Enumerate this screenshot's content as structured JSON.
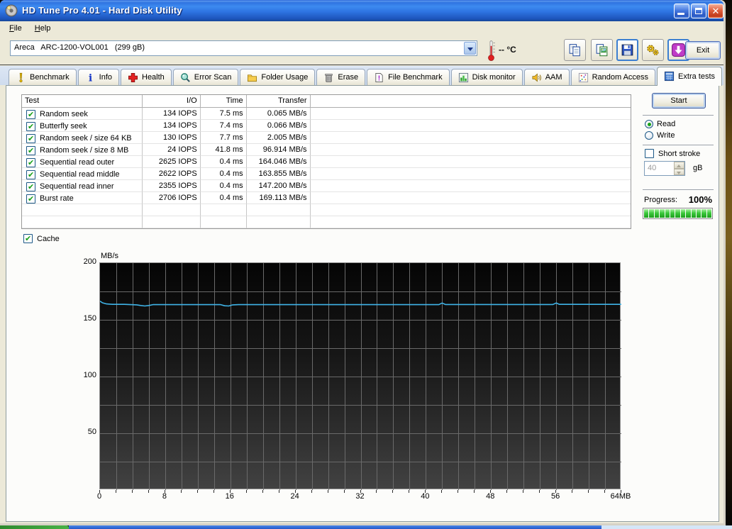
{
  "window": {
    "title": "HD Tune Pro 4.01 - Hard Disk Utility",
    "menu": [
      "File",
      "Help"
    ],
    "controls": [
      "minimize-icon",
      "restore-icon",
      "close-icon"
    ],
    "drive_selector": "Areca   ARC-1200-VOL001   (299 gB)",
    "temperature": "--  °C",
    "toolbar_buttons": [
      {
        "name": "copy-text-button",
        "icon": "copy-icon",
        "focused": false
      },
      {
        "name": "copy-image-button",
        "icon": "copy-image-icon",
        "focused": false
      },
      {
        "name": "save-button",
        "icon": "save-icon",
        "focused": true
      },
      {
        "name": "options-button",
        "icon": "options-icon",
        "focused": false
      },
      {
        "name": "download-button",
        "icon": "download-icon",
        "focused": true
      }
    ],
    "exit_label": "Exit"
  },
  "active_tab": "Extra tests",
  "tabs": [
    {
      "label": "Benchmark",
      "icon": "benchmark-icon"
    },
    {
      "label": "Info",
      "icon": "info-icon"
    },
    {
      "label": "Health",
      "icon": "health-icon"
    },
    {
      "label": "Error Scan",
      "icon": "error-scan-icon"
    },
    {
      "label": "Folder Usage",
      "icon": "folder-icon"
    },
    {
      "label": "Erase",
      "icon": "erase-icon"
    },
    {
      "label": "File Benchmark",
      "icon": "file-benchmark-icon"
    },
    {
      "label": "Disk monitor",
      "icon": "disk-monitor-icon"
    },
    {
      "label": "AAM",
      "icon": "aam-icon"
    },
    {
      "label": "Random Access",
      "icon": "random-access-icon"
    },
    {
      "label": "Extra tests",
      "icon": "extra-tests-icon"
    }
  ],
  "results_table": {
    "columns": [
      "Test",
      "I/O",
      "Time",
      "Transfer"
    ],
    "rows": [
      {
        "checked": true,
        "test": "Random seek",
        "io": "134 IOPS",
        "time": "7.5 ms",
        "transfer": "0.065 MB/s"
      },
      {
        "checked": true,
        "test": "Butterfly seek",
        "io": "134 IOPS",
        "time": "7.4 ms",
        "transfer": "0.066 MB/s"
      },
      {
        "checked": true,
        "test": "Random seek / size 64 KB",
        "io": "130 IOPS",
        "time": "7.7 ms",
        "transfer": "2.005 MB/s"
      },
      {
        "checked": true,
        "test": "Random seek / size 8 MB",
        "io": "24 IOPS",
        "time": "41.8 ms",
        "transfer": "96.914 MB/s"
      },
      {
        "checked": true,
        "test": "Sequential read outer",
        "io": "2625 IOPS",
        "time": "0.4 ms",
        "transfer": "164.046 MB/s"
      },
      {
        "checked": true,
        "test": "Sequential read middle",
        "io": "2622 IOPS",
        "time": "0.4 ms",
        "transfer": "163.855 MB/s"
      },
      {
        "checked": true,
        "test": "Sequential read inner",
        "io": "2355 IOPS",
        "time": "0.4 ms",
        "transfer": "147.200 MB/s"
      },
      {
        "checked": true,
        "test": "Burst rate",
        "io": "2706 IOPS",
        "time": "0.4 ms",
        "transfer": "169.113 MB/s"
      }
    ],
    "empty_row_count": 2
  },
  "controls": {
    "start_label": "Start",
    "read_label": "Read",
    "write_label": "Write",
    "read_selected": true,
    "short_stroke_label": "Short stroke",
    "short_stroke_checked": false,
    "short_stroke_value": "40",
    "short_stroke_unit": "gB",
    "progress_label": "Progress:",
    "progress_value": "100%",
    "progress_percent": 100,
    "progress_segments": 13
  },
  "cache": {
    "label": "Cache",
    "checked": true
  },
  "chart_data": {
    "type": "line",
    "title": "",
    "xlabel": "",
    "ylabel": "MB/s",
    "xlim": [
      0,
      64
    ],
    "ylim": [
      0,
      200
    ],
    "x_ticks": [
      0,
      8,
      16,
      24,
      32,
      40,
      48,
      56,
      64
    ],
    "x_tick_labels": [
      "0",
      "8",
      "16",
      "24",
      "32",
      "40",
      "48",
      "56",
      "64MB"
    ],
    "y_ticks": [
      200,
      150,
      100,
      50
    ],
    "x_minor_step": 2,
    "y_minor_step": 25,
    "grid": true,
    "grid_color": "#6a6a6a",
    "line_color": "#3fb4e8",
    "legend_position": "none",
    "series": [
      {
        "name": "Cache",
        "x": [
          0,
          0.3,
          0.8,
          1.5,
          3,
          4.5,
          5,
          5.5,
          6,
          6.5,
          8,
          10,
          12,
          14.8,
          15.3,
          15.8,
          16.3,
          17,
          20,
          24,
          28,
          32,
          36,
          40,
          41.6,
          42,
          42.4,
          44,
          48,
          52,
          55.6,
          56,
          56.4,
          58,
          61,
          63,
          64
        ],
        "y": [
          166.5,
          165,
          164,
          163.6,
          163.6,
          163.2,
          162.6,
          162.2,
          162.6,
          163.4,
          163.4,
          163.4,
          163.4,
          163.4,
          162.4,
          162.2,
          163.2,
          163.4,
          163.4,
          163.4,
          163.4,
          163.4,
          163.4,
          163.4,
          163.4,
          164.8,
          163.5,
          163.5,
          163.5,
          163.5,
          163.5,
          164.8,
          163.6,
          163.6,
          163.6,
          163.6,
          163.6
        ]
      }
    ]
  },
  "colors": {
    "titlebar_blue": "#2e74e2",
    "progress_green": "#3cc83c",
    "chart_line": "#3fb4e8",
    "close_red": "#d14a28"
  }
}
